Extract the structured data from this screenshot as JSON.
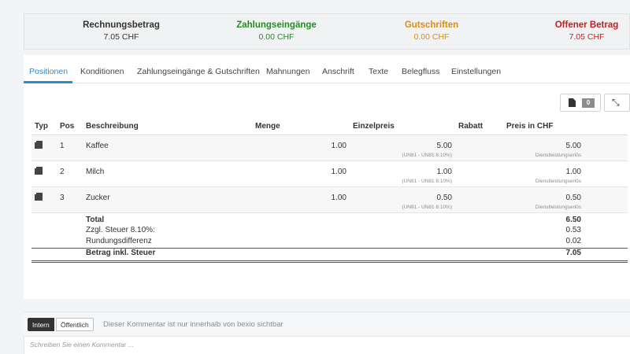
{
  "summary": {
    "total": {
      "label": "Rechnungsbetrag",
      "value": "7.05 CHF"
    },
    "payments": {
      "label": "Zahlungseingänge",
      "value": "0.00 CHF"
    },
    "credits": {
      "label": "Gutschriften",
      "value": "0.00 CHF"
    },
    "open": {
      "label": "Offener Betrag",
      "value": "7.05 CHF"
    }
  },
  "colors": {
    "accent": "#2a8bd0",
    "green": "#1f8f1f",
    "orange": "#df8b14",
    "red": "#c41f1f"
  },
  "tabs": [
    {
      "label": "Positionen"
    },
    {
      "label": "Konditionen"
    },
    {
      "label": "Zahlungseingänge & Gutschriften"
    },
    {
      "label": "Mahnungen"
    },
    {
      "label": "Anschrift"
    },
    {
      "label": "Texte"
    },
    {
      "label": "Belegfluss"
    },
    {
      "label": "Einstellungen"
    }
  ],
  "toolbar": {
    "doc_count": "0",
    "doc_icon": "document-icon",
    "collapse_icon": "compress-icon"
  },
  "table": {
    "headers": {
      "typ": "Typ",
      "pos": "Pos",
      "desc": "Beschreibung",
      "qty": "Menge",
      "unit": "Einzelpreis",
      "discount": "Rabatt",
      "price": "Preis in CHF"
    },
    "rows": [
      {
        "pos": "1",
        "desc": "Kaffee",
        "qty": "1.00",
        "unit": "5.00",
        "tax": "(UN81 - UN81 8.10%)",
        "price": "5.00",
        "account": "Dienstleistungserlös"
      },
      {
        "pos": "2",
        "desc": "Milch",
        "qty": "1.00",
        "unit": "1.00",
        "tax": "(UN81 - UN81 8.10%)",
        "price": "1.00",
        "account": "Dienstleistungserlös"
      },
      {
        "pos": "3",
        "desc": "Zucker",
        "qty": "1.00",
        "unit": "0.50",
        "tax": "(UN81 - UN81 8.10%)",
        "price": "0.50",
        "account": "Dienstleistungserlös"
      }
    ],
    "totals": {
      "total_label": "Total",
      "total_value": "6.50",
      "tax_label": "Zzgl. Steuer 8.10%:",
      "tax_value": "0.53",
      "rounding_label": "Rundungsdifferenz",
      "rounding_value": "0.02",
      "grand_label": "Betrag inkl. Steuer",
      "grand_value": "7.05"
    }
  },
  "comments": {
    "intern": "Intern",
    "public": "Öffentlich",
    "hint": "Dieser Kommentar ist nur innerhalb von bexio sichtbar",
    "placeholder": "Schreiben Sie einen Kommentar ..."
  }
}
